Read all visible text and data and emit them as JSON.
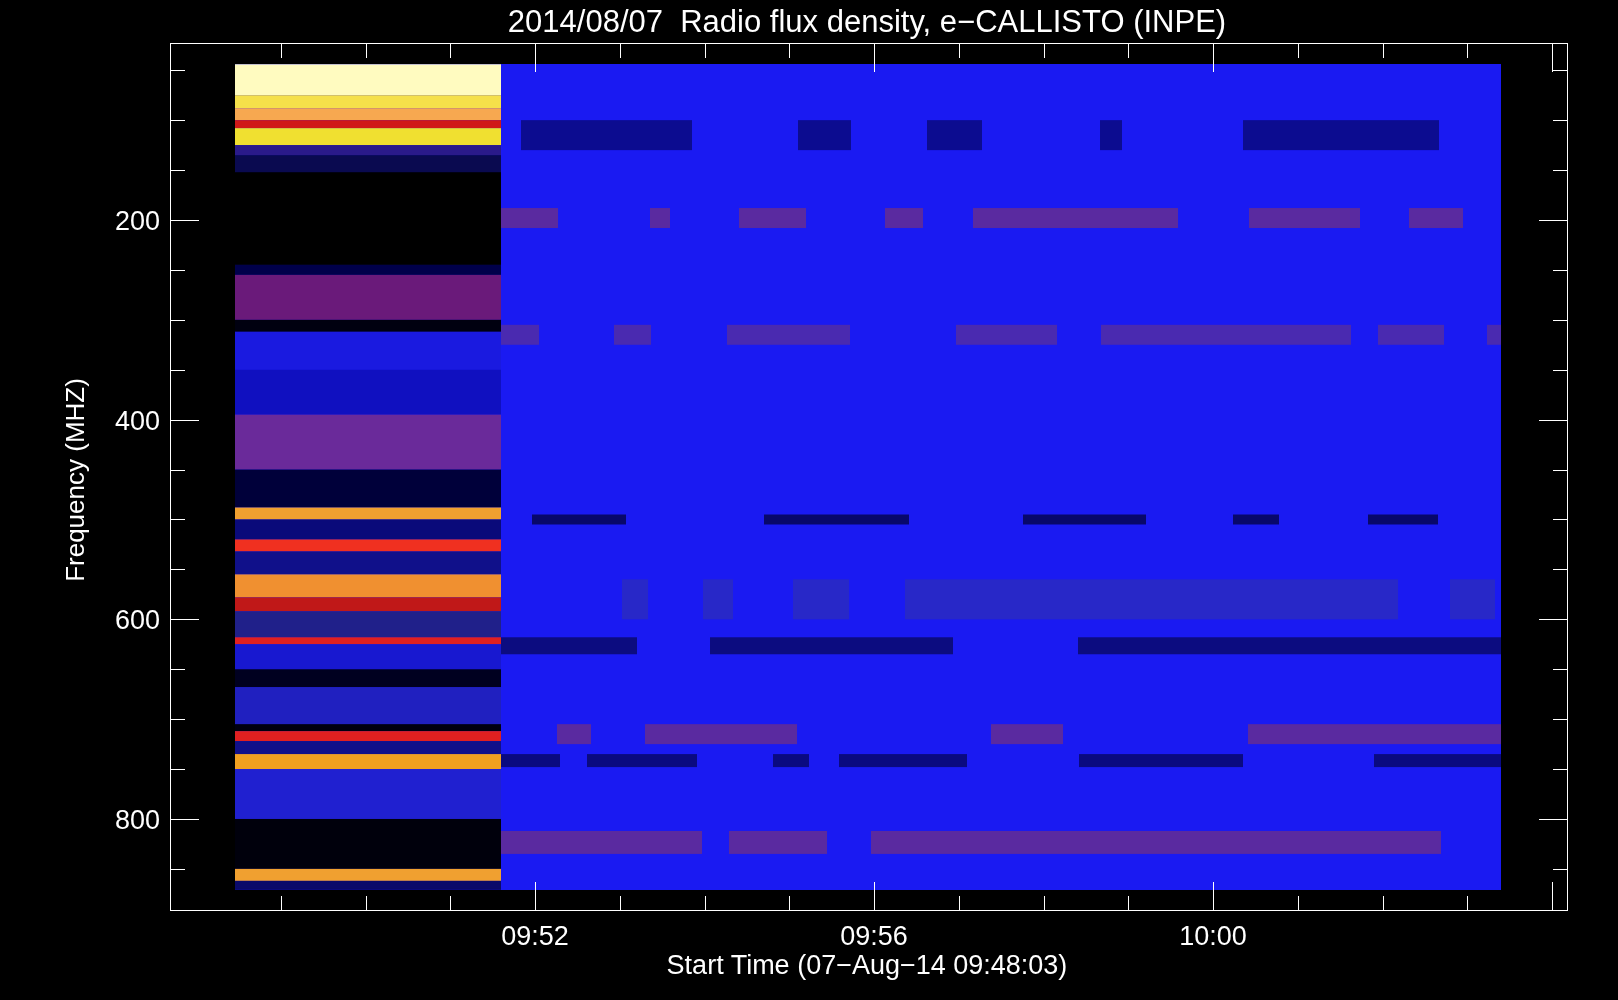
{
  "title": "2014/08/07  Radio flux density, e−CALLISTO (INPE)",
  "y_axis": {
    "label": "Frequency (MHZ)",
    "ticks": [
      "200",
      "400",
      "600",
      "800"
    ]
  },
  "x_axis": {
    "label": "Start Time (07−Aug−14 09:48:03)",
    "ticks": [
      "09:52",
      "09:56",
      "10:00"
    ]
  }
}
